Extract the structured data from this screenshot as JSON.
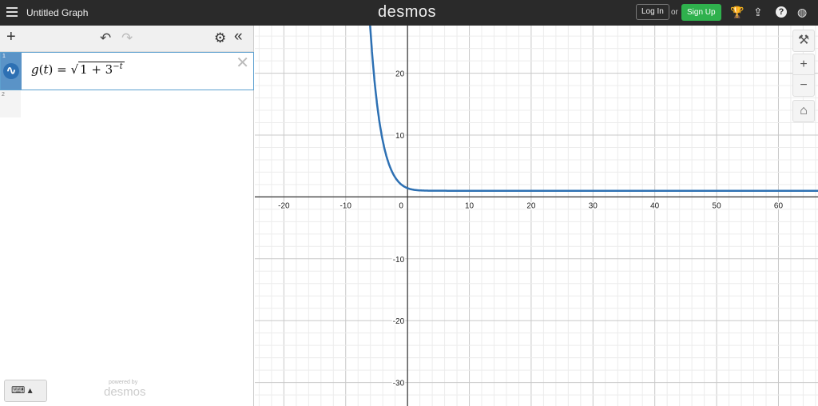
{
  "header": {
    "title": "Untitled Graph",
    "logo": "desmos",
    "login": "Log In",
    "or": "or",
    "signup": "Sign Up",
    "icons": [
      "trophy-icon",
      "share-icon",
      "help-icon",
      "globe-icon"
    ]
  },
  "panel": {
    "add": "+",
    "undo": "↶",
    "redo": "↷",
    "settings": "⚙",
    "collapse": "«",
    "expressions": [
      {
        "number": "1",
        "latex": "g(t)=\\sqrt{1+3^{-t}}",
        "fname": "g",
        "var": "t",
        "one": "1",
        "base": "3",
        "exp": "−t",
        "color": "#2d70b3"
      },
      {
        "number": "2"
      }
    ],
    "powered_by": "powered by",
    "powered_logo": "desmos"
  },
  "graph": {
    "function": "sqrt(1+3^(-t))",
    "curve_color": "#2d70b3",
    "x_range": [
      -24.7,
      66.4
    ],
    "y_range": [
      -33.8,
      27.7
    ],
    "x_ticks": [
      "-20",
      "-10",
      "0",
      "10",
      "20",
      "30",
      "40",
      "50",
      "60"
    ],
    "y_ticks": [
      "20",
      "10",
      "-10",
      "-20",
      "-30"
    ]
  },
  "right_tools": {
    "wrench": "🔧",
    "zoom_in": "+",
    "zoom_out": "−",
    "home": "⌂"
  }
}
